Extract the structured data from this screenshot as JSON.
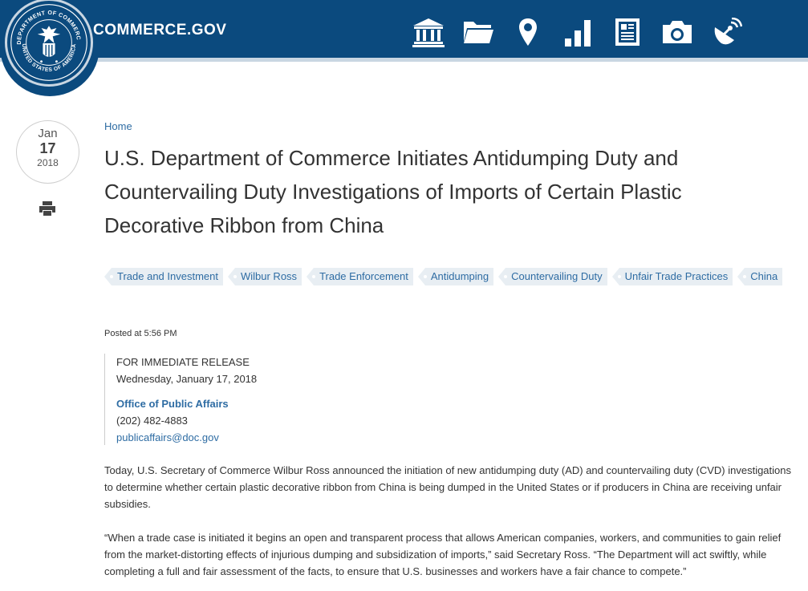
{
  "header": {
    "site_name": "COMMERCE.GOV",
    "seal_text_top": "DEPARTMENT OF COMMERCE",
    "seal_text_bottom": "UNITED STATES OF AMERICA",
    "nav_icons": [
      "bank-icon",
      "folder-icon",
      "map-pin-icon",
      "bar-chart-icon",
      "newspaper-icon",
      "camera-icon",
      "satellite-icon"
    ],
    "colors": {
      "header_bg": "#0b4a7e",
      "stripe": "#c9d6e2",
      "link": "#2e6ca3"
    }
  },
  "date": {
    "month": "Jan",
    "day": "17",
    "year": "2018"
  },
  "breadcrumb": "Home",
  "title": "U.S. Department of Commerce Initiates Antidumping Duty and Countervailing Duty Investigations of Imports of Certain Plastic Decorative Ribbon from China",
  "tags": [
    "Trade and Investment",
    "Wilbur Ross",
    "Trade Enforcement",
    "Antidumping",
    "Countervailing Duty",
    "Unfair Trade Practices",
    "China"
  ],
  "posted": "Posted at 5:56 PM",
  "release": {
    "label": "FOR IMMEDIATE RELEASE",
    "date": "Wednesday, January 17, 2018",
    "office": "Office of Public Affairs",
    "phone": "(202) 482-4883",
    "email": "publicaffairs@doc.gov"
  },
  "body": {
    "para1": "Today, U.S. Secretary of Commerce Wilbur Ross announced the initiation of new antidumping duty (AD) and countervailing duty (CVD) investigations to determine whether certain plastic decorative ribbon from China is being dumped in the United States or if producers in China are receiving unfair subsidies.",
    "para2": "“When a trade case is initiated it begins an open and transparent process that allows American companies, workers, and communities to gain relief from the market-distorting effects of injurious dumping and subsidization of imports,” said Secretary Ross. “The Department will act swiftly, while completing a full and fair assessment of the facts, to ensure that U.S. businesses and workers have a fair chance to compete.”"
  }
}
